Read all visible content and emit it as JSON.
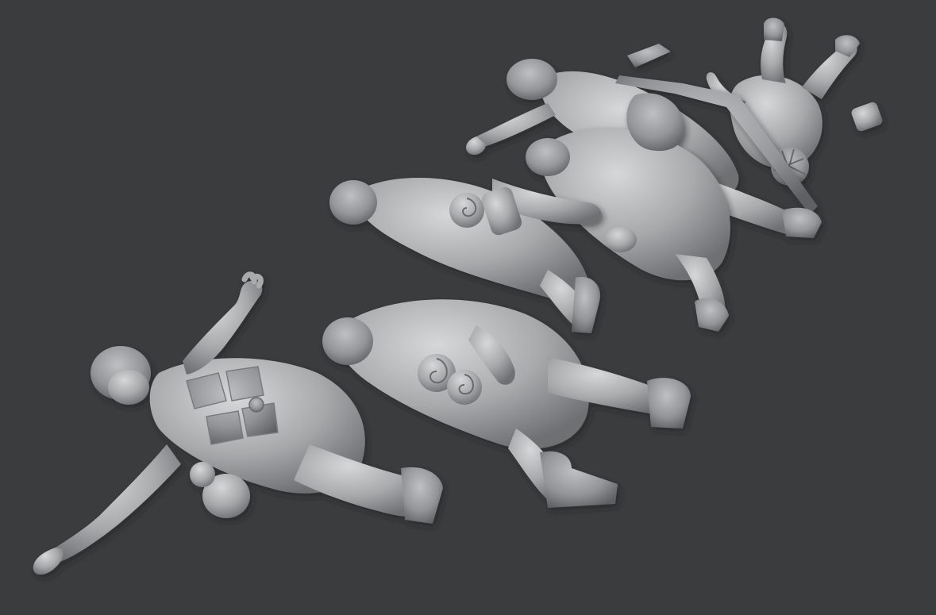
{
  "viewport": {
    "background_color": "#3b3c3e",
    "model_color": "#a9aaac",
    "model_highlight": "#d2d3d5",
    "model_shadow": "#6c6d70",
    "subject": "sculpted-figure-group"
  },
  "figures": [
    {
      "id": "figure-front",
      "pose": "lying-arms-spread"
    },
    {
      "id": "figure-middle-left",
      "pose": "lying-on-side"
    },
    {
      "id": "figure-middle-right",
      "pose": "lying-face-down"
    },
    {
      "id": "figure-back",
      "pose": "lying-with-rifle"
    },
    {
      "id": "figure-top-right",
      "pose": "lying-legs-raised"
    }
  ]
}
